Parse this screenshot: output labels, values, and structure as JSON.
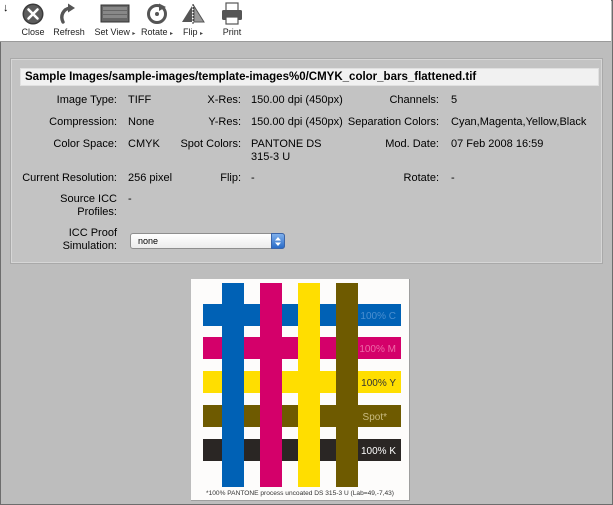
{
  "toolbar": {
    "corner_glyph": "↓",
    "buttons": [
      {
        "id": "close",
        "label": "Close",
        "icon": "close-icon",
        "menu": false
      },
      {
        "id": "refresh",
        "label": "Refresh",
        "icon": "refresh-icon",
        "menu": false
      },
      {
        "id": "setview",
        "label": "Set View",
        "icon": "set-view-icon",
        "menu": true
      },
      {
        "id": "rotate",
        "label": "Rotate",
        "icon": "rotate-icon",
        "menu": true
      },
      {
        "id": "flip",
        "label": "Flip",
        "icon": "flip-icon",
        "menu": true
      },
      {
        "id": "print",
        "label": "Print",
        "icon": "printer-icon",
        "menu": false
      }
    ],
    "menu_arrow": "▸"
  },
  "info": {
    "path": "Sample Images/sample-images/template-images%0/CMYK_color_bars_flattened.tif",
    "image_type_label": "Image Type:",
    "image_type_value": "TIFF",
    "xres_label": "X-Res:",
    "xres_value": "150.00 dpi (450px)",
    "channels_label": "Channels:",
    "channels_value": "5",
    "compression_label": "Compression:",
    "compression_value": "None",
    "yres_label": "Y-Res:",
    "yres_value": "150.00 dpi (450px)",
    "sepcolors_label": "Separation Colors:",
    "sepcolors_value": "Cyan,Magenta,Yellow,Black",
    "colorspace_label": "Color Space:",
    "colorspace_value": "CMYK",
    "spotcolors_label": "Spot Colors:",
    "spotcolors_value_line1": "PANTONE DS",
    "spotcolors_value_line2": "315-3 U",
    "moddate_label": "Mod. Date:",
    "moddate_value": "07 Feb 2008 16:59",
    "curres_label": "Current Resolution:",
    "curres_value": "256 pixel",
    "flip_label": "Flip:",
    "flip_value": "-",
    "rotate_label": "Rotate:",
    "rotate_value": "-",
    "source_icc_label_line1": "Source ICC",
    "source_icc_label_line2": "Profiles:",
    "source_icc_value": "-",
    "proof_label_line1": "ICC Proof",
    "proof_label_line2": "Simulation:",
    "proof_selected": "none"
  },
  "preview": {
    "bars": [
      {
        "label": "100% C",
        "color": "#0061b5",
        "label_color": "#4a8fd0"
      },
      {
        "label": "100% M",
        "color": "#d4006a",
        "label_color": "#ee6aa8"
      },
      {
        "label": "100% Y",
        "color": "#ffde00",
        "label_color": "#333333"
      },
      {
        "label": "Spot*",
        "color": "#6e5a00",
        "label_color": "#c9bb80"
      },
      {
        "label": "100% K",
        "color": "#2a2624",
        "label_color": "#ffffff"
      }
    ],
    "footnote": "*100% PANTONE process uncoated DS 315-3 U (Lab=49,-7,43)"
  }
}
